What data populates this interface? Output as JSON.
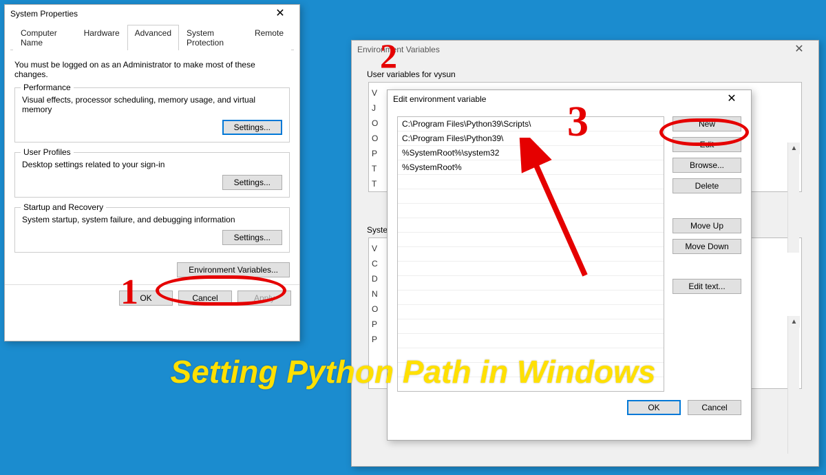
{
  "caption": "Setting Python Path in Windows",
  "annotations": {
    "one": "1",
    "two": "2",
    "three": "3"
  },
  "sysprops": {
    "title": "System Properties",
    "tabs": [
      "Computer Name",
      "Hardware",
      "Advanced",
      "System Protection",
      "Remote"
    ],
    "active_tab_index": 2,
    "admin_note": "You must be logged on as an Administrator to make most of these changes.",
    "performance": {
      "label": "Performance",
      "desc": "Visual effects, processor scheduling, memory usage, and virtual memory",
      "settings_btn": "Settings..."
    },
    "user_profiles": {
      "label": "User Profiles",
      "desc": "Desktop settings related to your sign-in",
      "settings_btn": "Settings..."
    },
    "startup": {
      "label": "Startup and Recovery",
      "desc": "System startup, system failure, and debugging information",
      "settings_btn": "Settings..."
    },
    "env_btn": "Environment Variables...",
    "ok": "OK",
    "cancel": "Cancel",
    "apply": "Apply"
  },
  "env_parent": {
    "title": "Environment Variables",
    "user_label": "User variables for vysun",
    "sys_label": "System variables",
    "peek_user": [
      "V",
      "J",
      "O",
      "O",
      "P",
      "T",
      "T"
    ],
    "peek_sys": [
      "V",
      "C",
      "D",
      "N",
      "O",
      "P",
      "P"
    ]
  },
  "edit": {
    "title": "Edit environment variable",
    "paths": [
      "C:\\Program Files\\Python39\\Scripts\\",
      "C:\\Program Files\\Python39\\",
      "%SystemRoot%\\system32",
      "%SystemRoot%"
    ],
    "buttons": {
      "new": "New",
      "edit": "Edit",
      "browse": "Browse...",
      "delete": "Delete",
      "moveup": "Move Up",
      "movedown": "Move Down",
      "edittext": "Edit text..."
    },
    "ok": "OK",
    "cancel": "Cancel"
  }
}
